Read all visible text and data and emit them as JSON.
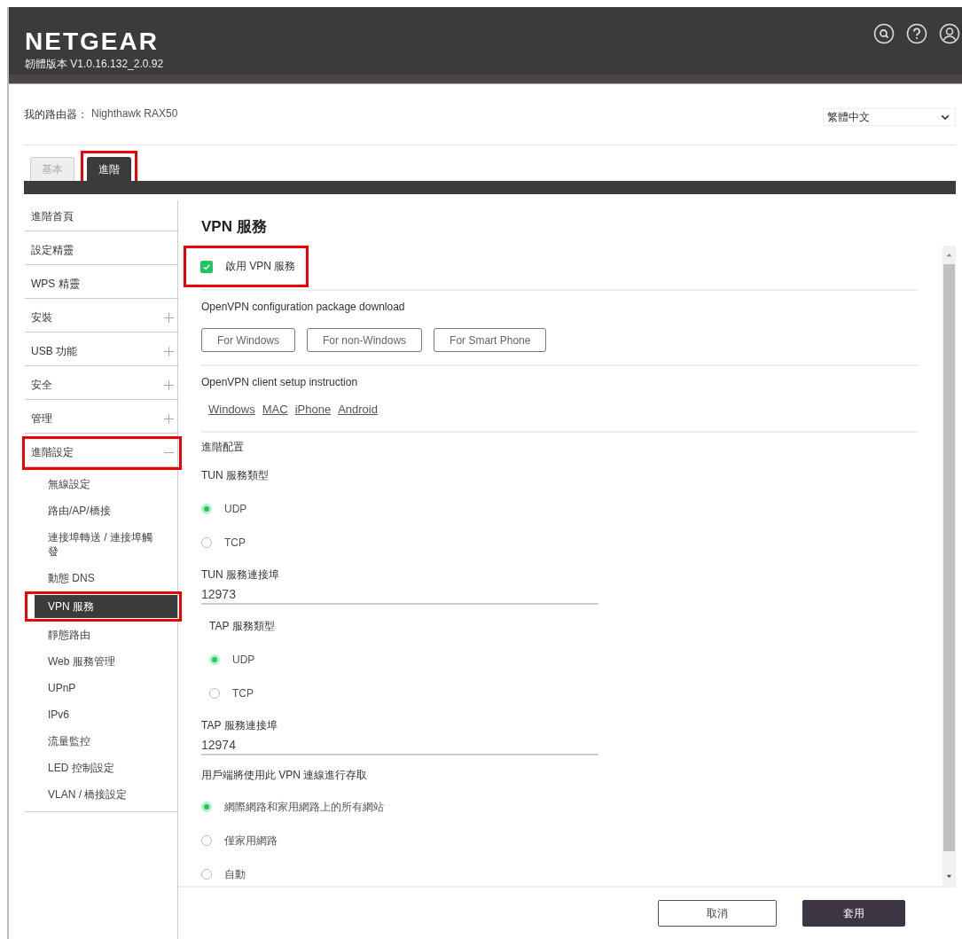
{
  "header": {
    "logo": "NETGEAR",
    "firmware": "韌體版本 V1.0.16.132_2.0.92"
  },
  "router": {
    "label": "我的路由器：",
    "name": "Nighthawk RAX50"
  },
  "language": {
    "value": "繁體中文"
  },
  "tabs": [
    {
      "label": "基本",
      "selected": false,
      "highlighted": false
    },
    {
      "label": "進階",
      "selected": true,
      "highlighted": true
    }
  ],
  "sidebar": {
    "items": [
      {
        "label": "進階首頁",
        "kind": "link",
        "highlighted": false
      },
      {
        "label": "設定精靈",
        "kind": "link",
        "highlighted": false
      },
      {
        "label": "WPS 精靈",
        "kind": "link",
        "highlighted": false
      },
      {
        "label": "安裝",
        "kind": "group",
        "expanded": false,
        "highlighted": false
      },
      {
        "label": "USB 功能",
        "kind": "group",
        "expanded": false,
        "highlighted": false
      },
      {
        "label": "安全",
        "kind": "group",
        "expanded": false,
        "highlighted": false
      },
      {
        "label": "管理",
        "kind": "group",
        "expanded": false,
        "highlighted": false
      },
      {
        "label": "進階設定",
        "kind": "group",
        "expanded": true,
        "highlighted": true,
        "children": [
          {
            "label": "無線設定",
            "selected": false,
            "highlighted": false
          },
          {
            "label": "路由/AP/橋接",
            "selected": false,
            "highlighted": false
          },
          {
            "label": "連接埠轉送 / 連接埠觸發",
            "selected": false,
            "highlighted": false
          },
          {
            "label": "動態 DNS",
            "selected": false,
            "highlighted": false
          },
          {
            "label": "VPN 服務",
            "selected": true,
            "highlighted": true
          },
          {
            "label": "靜態路由",
            "selected": false,
            "highlighted": false
          },
          {
            "label": "Web 服務管理",
            "selected": false,
            "highlighted": false
          },
          {
            "label": "UPnP",
            "selected": false,
            "highlighted": false
          },
          {
            "label": "IPv6",
            "selected": false,
            "highlighted": false
          },
          {
            "label": "流量監控",
            "selected": false,
            "highlighted": false
          },
          {
            "label": "LED 控制設定",
            "selected": false,
            "highlighted": false
          },
          {
            "label": "VLAN / 橋接設定",
            "selected": false,
            "highlighted": false
          }
        ]
      }
    ]
  },
  "main": {
    "title": "VPN 服務",
    "enable": {
      "label": "啟用 VPN 服務",
      "checked": true,
      "highlighted": true
    },
    "download": {
      "label": "OpenVPN configuration package download",
      "buttons": [
        "For Windows",
        "For non-Windows",
        "For Smart Phone"
      ]
    },
    "instructions": {
      "label": "OpenVPN client setup instruction",
      "links": [
        "Windows",
        "MAC",
        "iPhone",
        "Android"
      ]
    },
    "advanced": {
      "heading": "進階配置",
      "tun_type": {
        "label": "TUN 服務類型",
        "options": [
          {
            "label": "UDP",
            "selected": true
          },
          {
            "label": "TCP",
            "selected": false
          }
        ]
      },
      "tun_port": {
        "label": "TUN 服務連接埠",
        "value": "12973"
      },
      "tap_type": {
        "label": "TAP 服務類型",
        "options": [
          {
            "label": "UDP",
            "selected": true
          },
          {
            "label": "TCP",
            "selected": false
          }
        ]
      },
      "tap_port": {
        "label": "TAP 服務連接埠",
        "value": "12974"
      },
      "access": {
        "label": "用戶端將使用此 VPN 連線進行存取",
        "options": [
          {
            "label": "網際網路和家用網路上的所有網站",
            "selected": true
          },
          {
            "label": "僅家用網路",
            "selected": false
          },
          {
            "label": "自動",
            "selected": false
          }
        ]
      }
    }
  },
  "footer": {
    "buttons": [
      {
        "label": "取消",
        "kind": "secondary"
      },
      {
        "label": "套用",
        "kind": "primary"
      }
    ]
  }
}
